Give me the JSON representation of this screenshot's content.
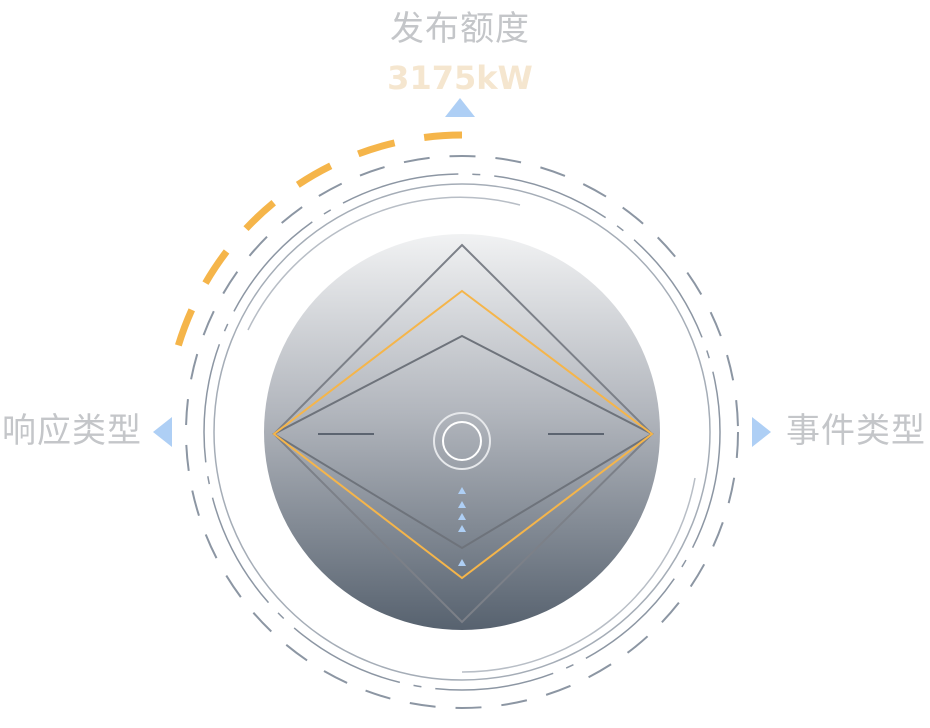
{
  "top": {
    "title": "发布额度",
    "value": "3175kW"
  },
  "left": {
    "label": "响应类型"
  },
  "right": {
    "label": "事件类型"
  },
  "colors": {
    "accent_orange": "#f5b54a",
    "value_text": "#f5e6cf",
    "label_text": "#c4c6c9",
    "pointer_blue": "#aecff5",
    "ring_stroke": "#8c96a3"
  }
}
